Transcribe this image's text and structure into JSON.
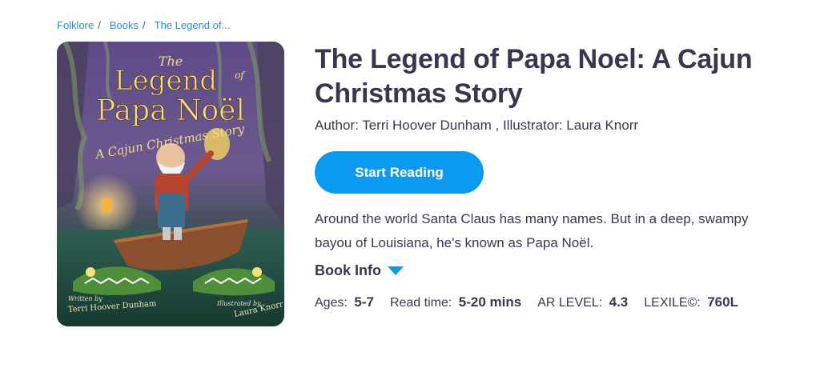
{
  "breadcrumb": [
    {
      "label": "Folklore"
    },
    {
      "label": "Books"
    },
    {
      "label": "The Legend of..."
    }
  ],
  "breadcrumb_separator": "/",
  "book": {
    "title": "The Legend of Papa Noel: A Cajun Christmas Story",
    "credits": "Author: Terri Hoover Dunham , Illustrator: Laura Knorr",
    "start_label": "Start Reading",
    "description": "Around the world Santa Claus has many names. But in a deep, swampy bayou of Louisiana, he's known as Papa Noël.",
    "book_info_label": "Book Info"
  },
  "cover": {
    "title_line1": "The",
    "title_line2": "Legend",
    "title_of": "of",
    "title_line3": "Papa Noël",
    "subtitle": "A Cajun Christmas Story",
    "written_by": "Written by",
    "author": "Terri Hoover Dunham",
    "illustrated_by": "Illustrated by",
    "illustrator": "Laura Knorr"
  },
  "meta": {
    "ages_label": "Ages:",
    "ages_value": "5-7",
    "read_label": "Read time:",
    "read_value": "5-20 mins",
    "ar_label": "AR LEVEL:",
    "ar_value": "4.3",
    "lexile_label": "LEXILE©:",
    "lexile_value": "760L"
  },
  "colors": {
    "accent": "#0b9af0",
    "link": "#1e90d6",
    "text": "#37374f"
  }
}
